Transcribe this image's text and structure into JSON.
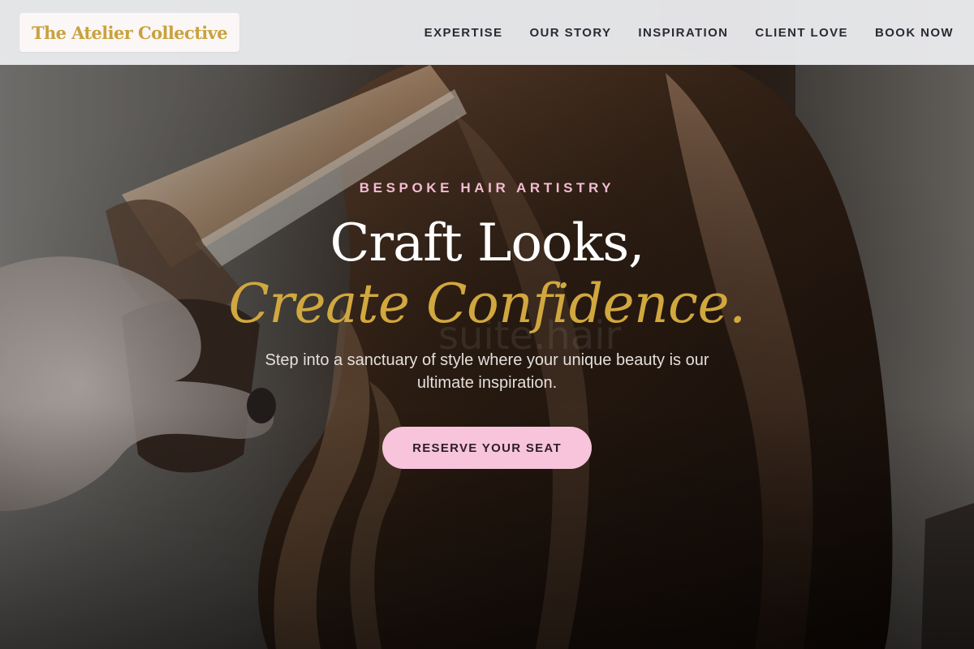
{
  "header": {
    "brand": "The Atelier Collective",
    "nav": [
      {
        "label": "EXPERTISE"
      },
      {
        "label": "OUR STORY"
      },
      {
        "label": "INSPIRATION"
      },
      {
        "label": "CLIENT LOVE"
      },
      {
        "label": "BOOK NOW"
      }
    ]
  },
  "hero": {
    "eyebrow": "BESPOKE HAIR ARTISTRY",
    "headline_line1": "Craft Looks,",
    "headline_line2": "Create Confidence.",
    "subtitle": "Step into a sanctuary of style where your unique beauty is our ultimate inspiration.",
    "cta_label": "RESERVE YOUR SEAT",
    "background_image": "stylist-curling-hair-photo"
  },
  "colors": {
    "brand_gold": "#c9a23e",
    "headline_gold": "#d1a83f",
    "accent_pink": "#f7c4db",
    "eyebrow_pink": "#f3bcd2",
    "nav_text": "#2a2a35",
    "header_bg": "#e8e9eb"
  }
}
